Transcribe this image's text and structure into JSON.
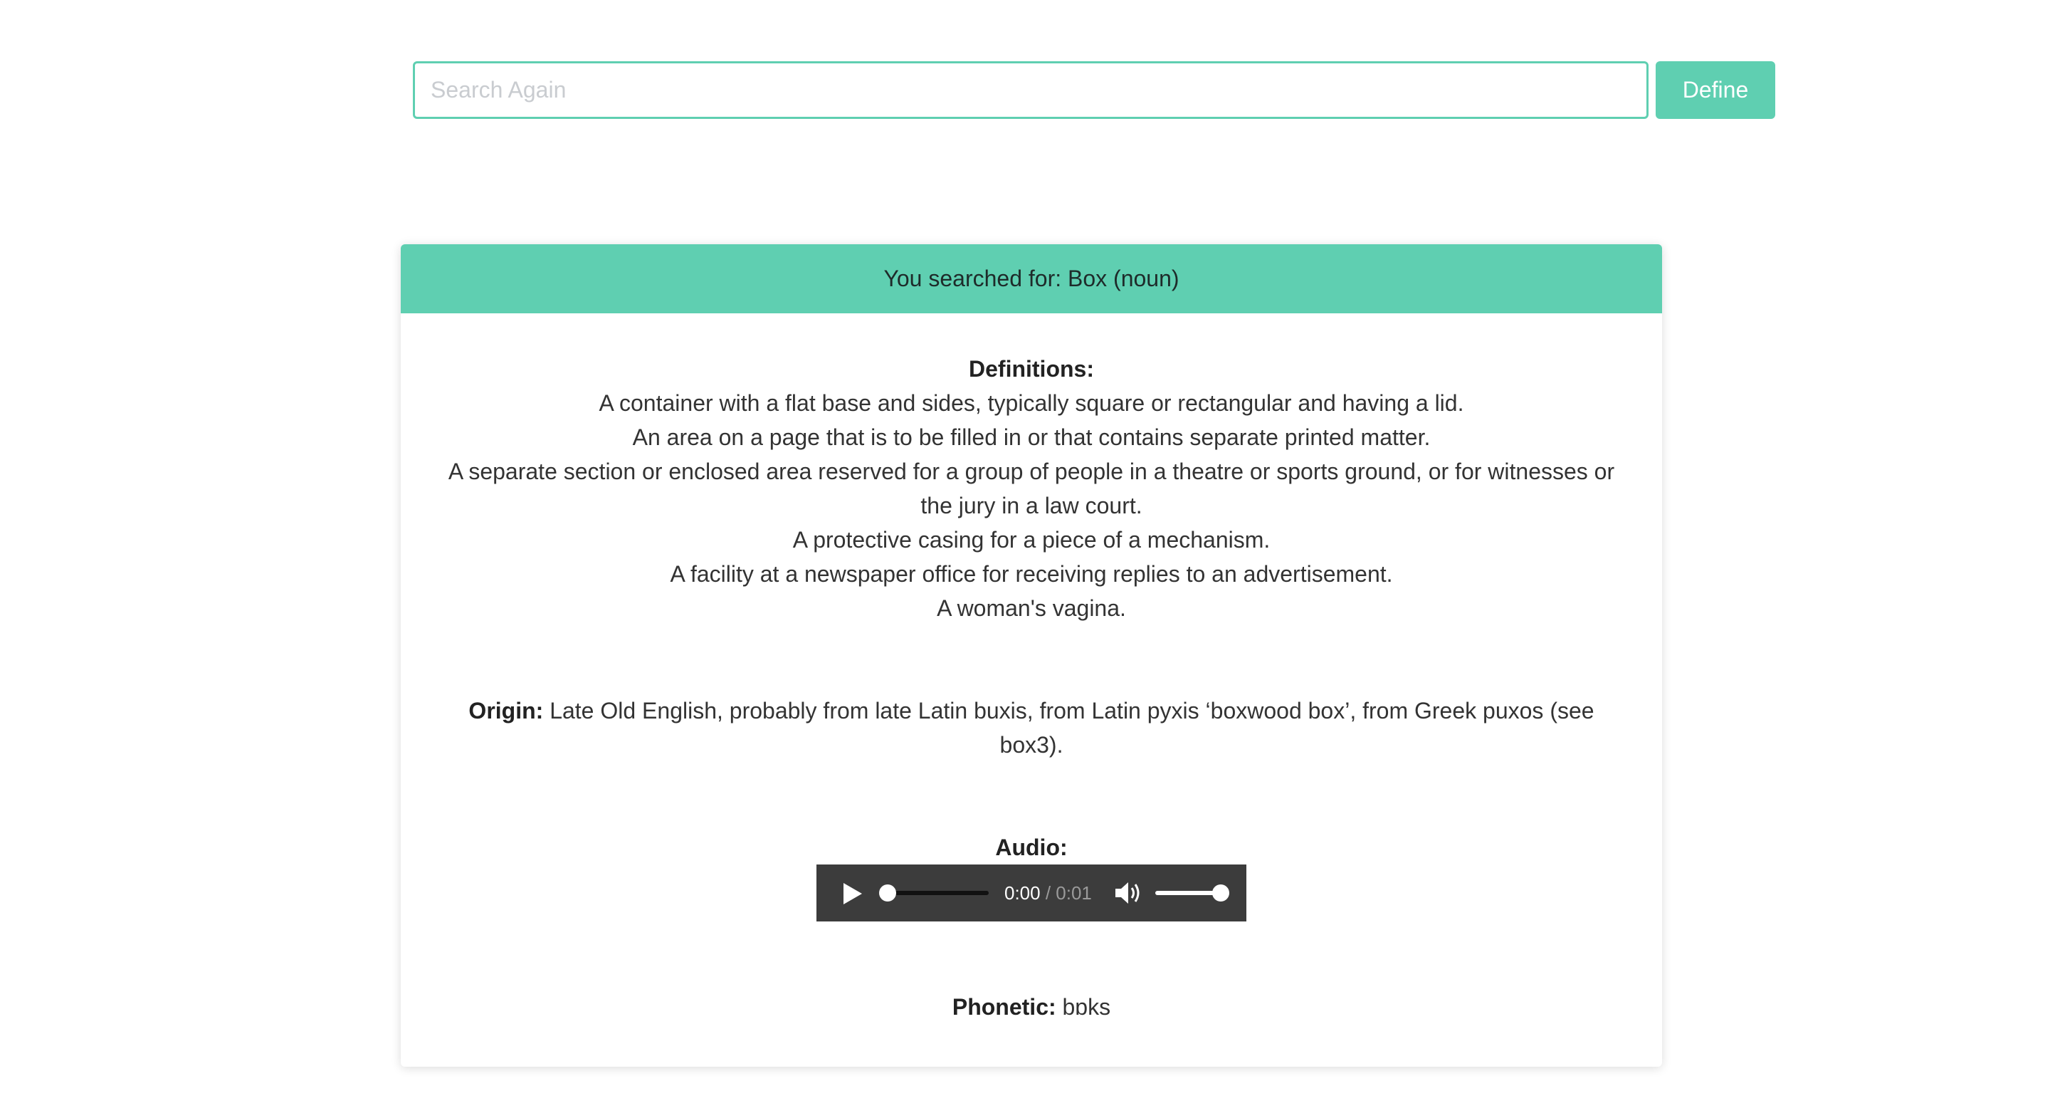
{
  "search": {
    "placeholder": "Search Again",
    "value": "",
    "button_label": "Define"
  },
  "result": {
    "header": "You searched for: Box (noun)",
    "definitions_label": "Definitions:",
    "definitions": [
      "A container with a flat base and sides, typically square or rectangular and having a lid.",
      "An area on a page that is to be filled in or that contains separate printed matter.",
      "A separate section or enclosed area reserved for a group of people in a theatre or sports ground, or for witnesses or the jury in a law court.",
      "A protective casing for a piece of a mechanism.",
      "A facility at a newspaper office for receiving replies to an advertisement.",
      "A woman's vagina."
    ],
    "origin_label": "Origin:",
    "origin_text": "Late Old English, probably from late Latin buxis, from Latin pyxis ‘boxwood box’, from Greek puxos (see box3).",
    "audio_label": "Audio:",
    "audio": {
      "current_time": "0:00",
      "total_time": "/ 0:01",
      "progress": 0,
      "volume": 1
    },
    "phonetic_label": "Phonetic:",
    "phonetic_text": "bɒks"
  },
  "colors": {
    "accent": "#5fcfb1",
    "player_bg": "#3c3c3c"
  }
}
